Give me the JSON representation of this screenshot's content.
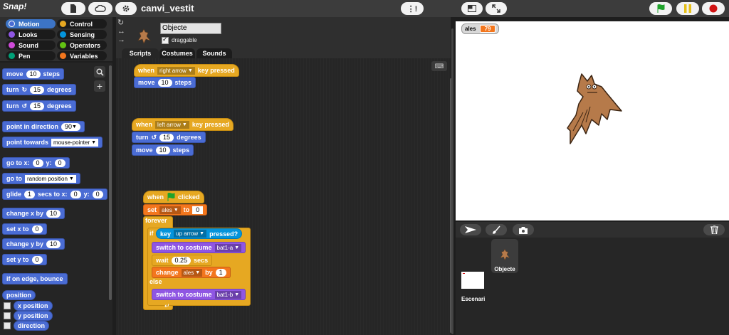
{
  "topbar": {
    "logo_text": "Snap!",
    "project_title": "canvi_vestit",
    "colors": {
      "green_flag": "#1fa32b",
      "pause": "#e6c019",
      "stop": "#d11414"
    }
  },
  "categories": [
    {
      "label": "Motion",
      "color": "#4a6cd4",
      "selected": true
    },
    {
      "label": "Control",
      "color": "#e6a822"
    },
    {
      "label": "Looks",
      "color": "#8f56e3"
    },
    {
      "label": "Sensing",
      "color": "#0494dc"
    },
    {
      "label": "Sound",
      "color": "#cf4ad9"
    },
    {
      "label": "Operators",
      "color": "#62c213"
    },
    {
      "label": "Pen",
      "color": "#00a178"
    },
    {
      "label": "Variables",
      "color": "#f3761d"
    }
  ],
  "palette": {
    "move": {
      "label": "move",
      "value": "10",
      "suffix": "steps"
    },
    "turn_cw": {
      "label": "turn",
      "value": "15",
      "suffix": "degrees"
    },
    "turn_ccw": {
      "label": "turn",
      "value": "15",
      "suffix": "degrees"
    },
    "point_dir": {
      "label": "point in direction",
      "value": "90"
    },
    "point_towards": {
      "label": "point towards",
      "value": "mouse-pointer"
    },
    "goto_xy": {
      "label": "go to x:",
      "x": "0",
      "ylabel": "y:",
      "y": "0"
    },
    "goto": {
      "label": "go to",
      "value": "random position"
    },
    "glide": {
      "label": "glide",
      "secs": "1",
      "mid": "secs to x:",
      "x": "0",
      "ylabel": "y:",
      "y": "0"
    },
    "change_x": {
      "label": "change x by",
      "value": "10"
    },
    "set_x": {
      "label": "set x to",
      "value": "0"
    },
    "change_y": {
      "label": "change y by",
      "value": "10"
    },
    "set_y": {
      "label": "set y to",
      "value": "0"
    },
    "bounce": {
      "label": "if on edge, bounce"
    },
    "position": {
      "label": "position"
    },
    "x_position": {
      "label": "x position"
    },
    "y_position": {
      "label": "y position"
    },
    "direction": {
      "label": "direction"
    }
  },
  "sprite": {
    "name": "Objecte",
    "draggable_label": "draggable"
  },
  "tabs": [
    "Scripts",
    "Costumes",
    "Sounds"
  ],
  "scripts": {
    "s1": {
      "hat": {
        "when": "when",
        "key": "right arrow",
        "pressed": "key pressed"
      },
      "move": {
        "label": "move",
        "value": "10",
        "suffix": "steps"
      }
    },
    "s2": {
      "hat": {
        "when": "when",
        "key": "left arrow",
        "pressed": "key pressed"
      },
      "turn": {
        "label": "turn",
        "value": "15",
        "suffix": "degrees"
      },
      "move": {
        "label": "move",
        "value": "10",
        "suffix": "steps"
      }
    },
    "s3": {
      "hat": {
        "when": "when",
        "clicked": "clicked"
      },
      "set": {
        "label": "set",
        "var": "ales",
        "to": "to",
        "value": "0"
      },
      "forever": "forever",
      "if": "if",
      "key": {
        "label": "key",
        "key": "up arrow",
        "pressed": "pressed?"
      },
      "switch1": {
        "label": "switch to costume",
        "value": "bat1-a"
      },
      "wait": {
        "label": "wait",
        "value": "0.25",
        "suffix": "secs"
      },
      "change": {
        "label": "change",
        "var": "ales",
        "by": "by",
        "value": "1"
      },
      "else": "else",
      "switch2": {
        "label": "switch to costume",
        "value": "bat1-b"
      }
    }
  },
  "stage": {
    "watcher": {
      "label": "ales",
      "value": "79"
    }
  },
  "corral": {
    "sprites": [
      {
        "name": "Objecte"
      }
    ],
    "stage_label": "Escenari"
  }
}
